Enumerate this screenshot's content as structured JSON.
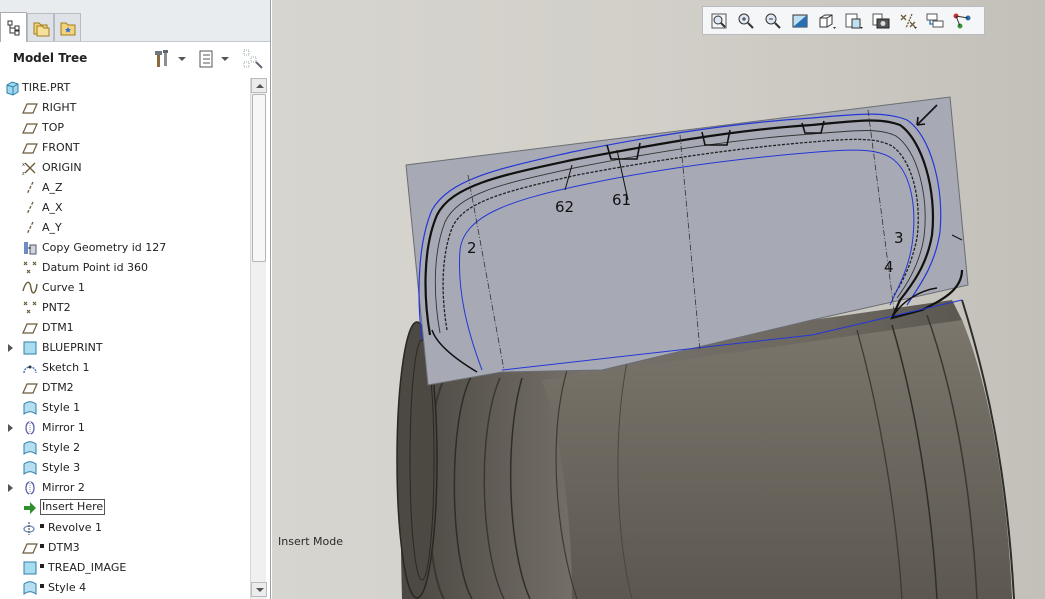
{
  "panel": {
    "title": "Model Tree",
    "tabs": [
      {
        "icon": "model-tree-tab-icon"
      },
      {
        "icon": "folder-browser-tab-icon"
      },
      {
        "icon": "favorites-tab-icon"
      }
    ],
    "tools": [
      "settings-hammer-icon",
      "show-columns-icon",
      "filter-icon"
    ]
  },
  "tree": {
    "root": {
      "label": "TIRE.PRT",
      "icon": "part-icon"
    },
    "items": [
      {
        "label": "RIGHT",
        "icon": "datum-plane-icon"
      },
      {
        "label": "TOP",
        "icon": "datum-plane-icon"
      },
      {
        "label": "FRONT",
        "icon": "datum-plane-icon"
      },
      {
        "label": "ORIGIN",
        "icon": "coordinate-system-icon"
      },
      {
        "label": "A_Z",
        "icon": "datum-axis-icon"
      },
      {
        "label": "A_X",
        "icon": "datum-axis-icon"
      },
      {
        "label": "A_Y",
        "icon": "datum-axis-icon"
      },
      {
        "label": "Copy Geometry id 127",
        "icon": "copy-geometry-icon"
      },
      {
        "label": "Datum Point id 360",
        "icon": "datum-point-icon"
      },
      {
        "label": "Curve 1",
        "icon": "curve-icon"
      },
      {
        "label": "PNT2",
        "icon": "datum-point-icon"
      },
      {
        "label": "DTM1",
        "icon": "datum-plane-icon"
      },
      {
        "label": "BLUEPRINT",
        "icon": "blueprint-icon",
        "expandable": true
      },
      {
        "label": "Sketch 1",
        "icon": "sketch-icon"
      },
      {
        "label": "DTM2",
        "icon": "datum-plane-icon"
      },
      {
        "label": "Style 1",
        "icon": "style-icon"
      },
      {
        "label": "Mirror 1",
        "icon": "mirror-icon",
        "expandable": true
      },
      {
        "label": "Style 2",
        "icon": "style-icon"
      },
      {
        "label": "Style 3",
        "icon": "style-icon"
      },
      {
        "label": "Mirror 2",
        "icon": "mirror-icon",
        "expandable": true
      },
      {
        "label": "Insert Here",
        "icon": "insert-arrow-icon",
        "boxed": true
      },
      {
        "label": "Revolve 1",
        "icon": "revolve-icon",
        "suppressed": true
      },
      {
        "label": "DTM3",
        "icon": "datum-plane-icon",
        "suppressed": true
      },
      {
        "label": "TREAD_IMAGE",
        "icon": "image-icon",
        "suppressed": true
      },
      {
        "label": "Style 4",
        "icon": "style-icon",
        "suppressed": true
      }
    ]
  },
  "viewport": {
    "status_text": "Insert Mode",
    "toolbar": [
      "refit-icon",
      "zoom-in-icon",
      "zoom-out-icon",
      "repaint-icon",
      "display-style-icon",
      "saved-orientations-icon",
      "view-manager-icon",
      "datum-display-filters-icon",
      "spin-center-icon",
      "annotation-display-icon"
    ],
    "sketch_labels": [
      "62",
      "61",
      "2",
      "3",
      "4"
    ],
    "colors": {
      "sketch_blue": "#2436d6",
      "plane_fill": "#a7aab4",
      "wheel": "#6e6a61"
    }
  }
}
